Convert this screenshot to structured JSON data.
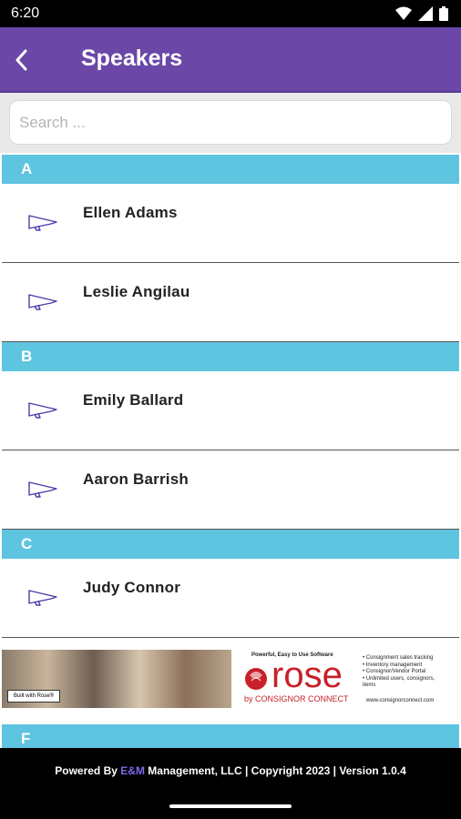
{
  "status_bar": {
    "time": "6:20"
  },
  "app_bar": {
    "title": "Speakers"
  },
  "search": {
    "placeholder": "Search ..."
  },
  "sections": [
    {
      "letter": "A",
      "items": [
        "Ellen Adams",
        "Leslie Angilau"
      ]
    },
    {
      "letter": "B",
      "items": [
        "Emily Ballard",
        "Aaron Barrish"
      ]
    },
    {
      "letter": "C",
      "items": [
        "Judy Connor"
      ]
    }
  ],
  "next_section": {
    "letter": "F"
  },
  "ad": {
    "tagline": "Powerful, Easy to Use Software",
    "photo_badge": "Built with Rose®",
    "brand": "rose",
    "brand_sub": "by CONSIGNOR CONNECT",
    "features": [
      "• Consignment sales tracking",
      "• Inventory management",
      "• Consignor/Vendor Portal",
      "• Unlimited users, consignors,",
      "  items"
    ],
    "url": "www.consignorconnect.com",
    "brand_color": "#c8202a"
  },
  "footer": {
    "prefix": "Powered By ",
    "company_highlight": "E&M",
    "suffix": " Management, LLC | Copyright 2023 | Version 1.0.4"
  },
  "colors": {
    "app_bar": "#6b47a8",
    "section_header": "#5ec4e0",
    "icon_stroke": "#4b3aa8"
  }
}
